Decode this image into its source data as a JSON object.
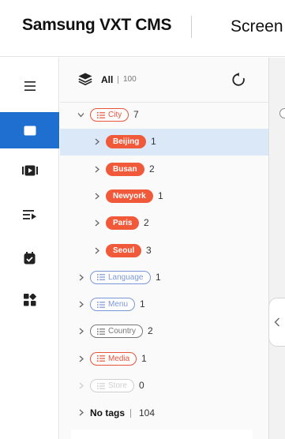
{
  "header": {
    "brand": "Samsung VXT CMS",
    "section_title": "Screen"
  },
  "sidebar": {
    "items": [
      {
        "icon": "menu-icon",
        "active": false
      },
      {
        "icon": "screen-icon",
        "active": true
      },
      {
        "icon": "content-icon",
        "active": false
      },
      {
        "icon": "playlist-icon",
        "active": false
      },
      {
        "icon": "schedule-icon",
        "active": false
      },
      {
        "icon": "apps-icon",
        "active": false
      }
    ]
  },
  "tree": {
    "all_label": "All",
    "all_count": "100",
    "groups": [
      {
        "label": "City",
        "count": "7",
        "expanded": true,
        "color": "#e8533a",
        "children": [
          {
            "label": "Beijing",
            "count": "1",
            "selected": true
          },
          {
            "label": "Busan",
            "count": "2",
            "selected": false
          },
          {
            "label": "Newyork",
            "count": "1",
            "selected": false
          },
          {
            "label": "Paris",
            "count": "2",
            "selected": false
          },
          {
            "label": "Seoul",
            "count": "3",
            "selected": false
          }
        ]
      },
      {
        "label": "Language",
        "count": "1",
        "expanded": false,
        "color": "#7b96d8"
      },
      {
        "label": "Menu",
        "count": "1",
        "expanded": false,
        "color": "#7b96d8"
      },
      {
        "label": "Country",
        "count": "2",
        "expanded": false,
        "color": "#777777"
      },
      {
        "label": "Media",
        "count": "1",
        "expanded": false,
        "color": "#e8533a"
      },
      {
        "label": "Store",
        "count": "0",
        "expanded": false,
        "color": "#cccccc",
        "disabled": true
      }
    ],
    "no_tags_label": "No tags",
    "no_tags_count": "104"
  },
  "colors": {
    "accent": "#1e6fd0",
    "tag_red": "#f05a3a",
    "selected_row": "#dbe8f8"
  }
}
